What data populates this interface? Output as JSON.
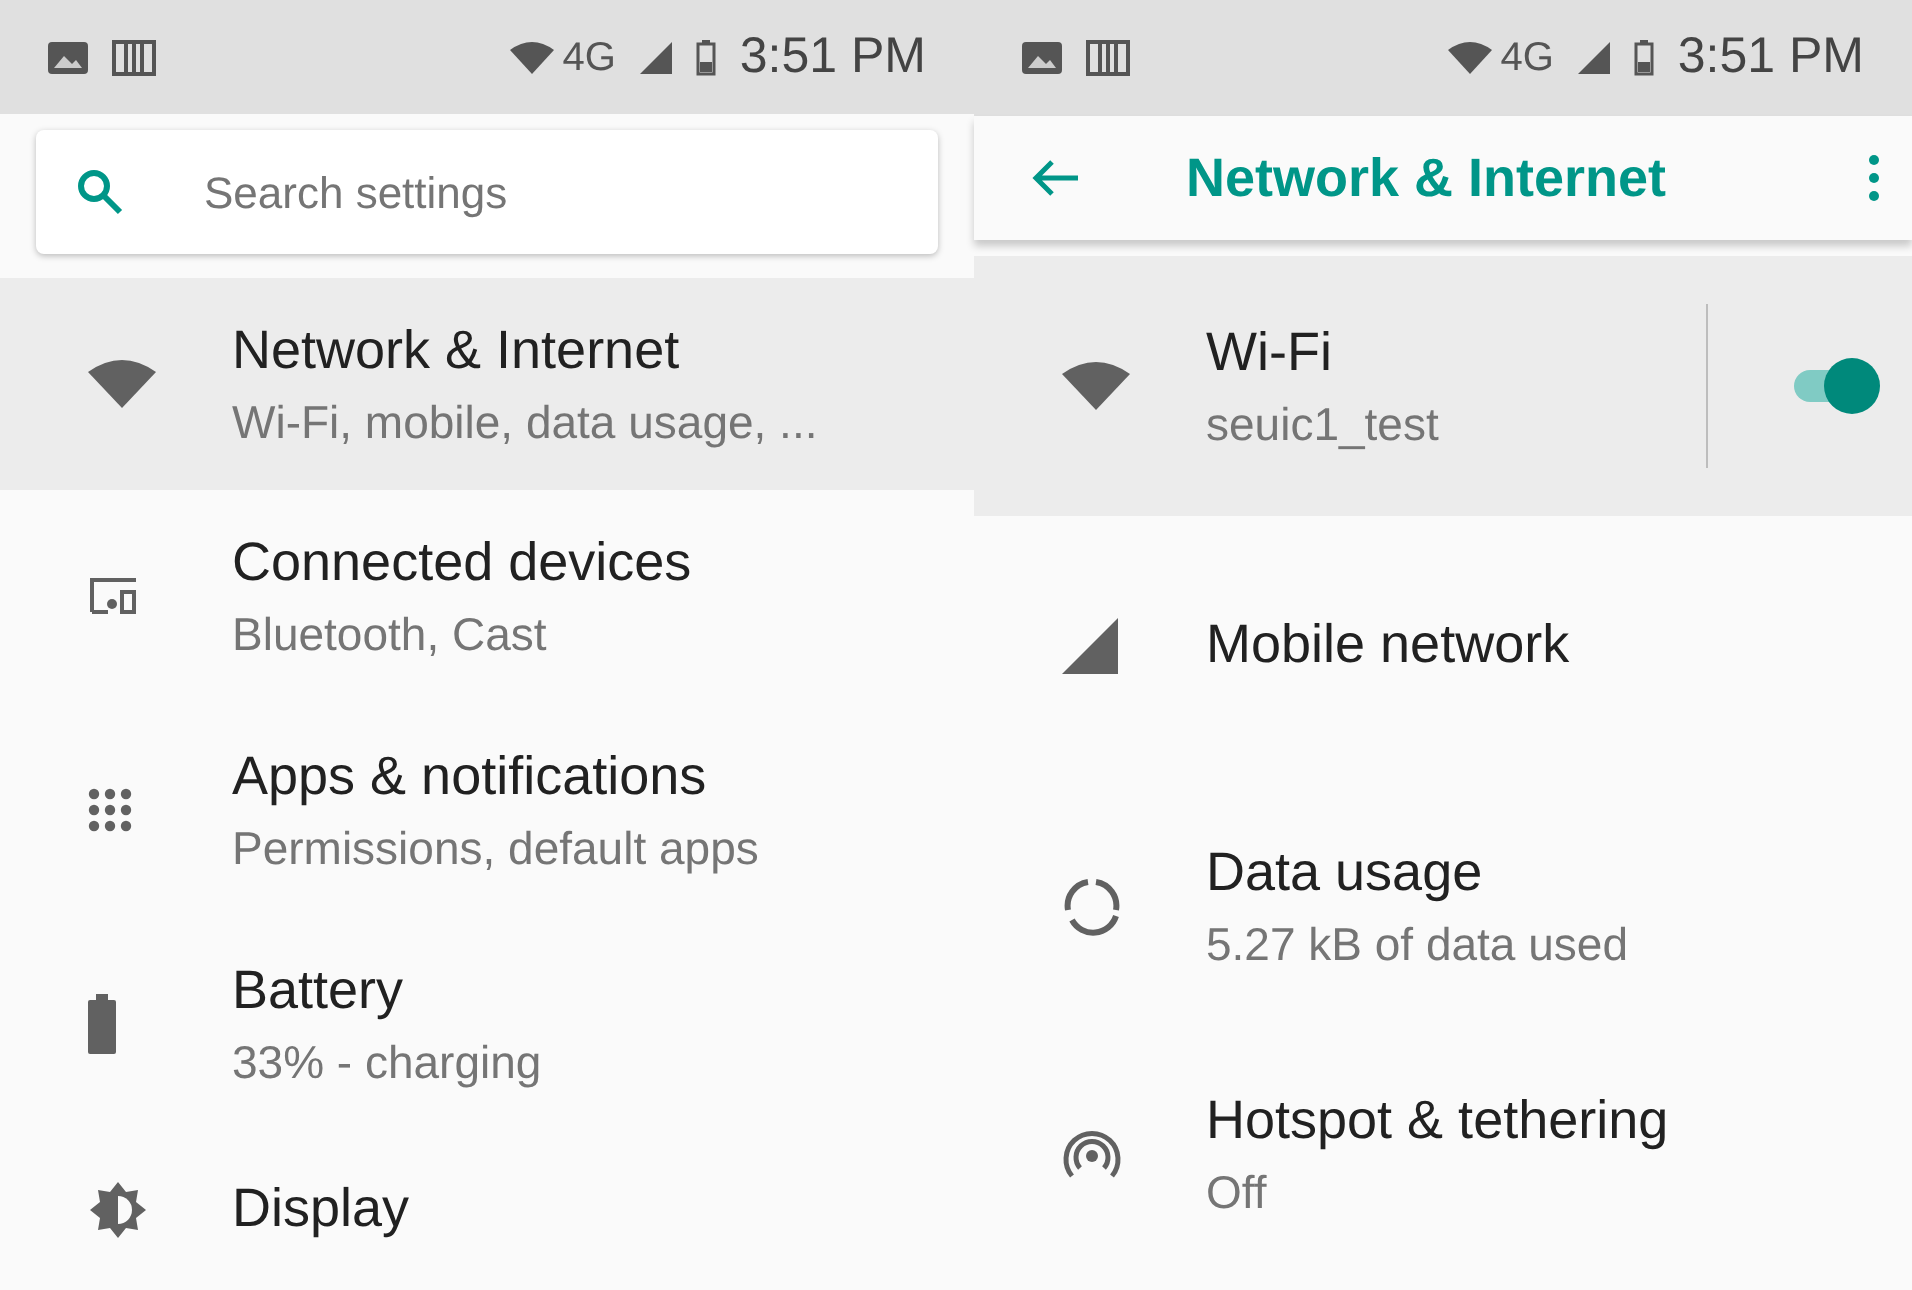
{
  "left_screen": {
    "status_bar": {
      "time": "3:51 PM",
      "network": "4G"
    },
    "search": {
      "placeholder": "Search settings"
    },
    "items": [
      {
        "title": "Network & Internet",
        "subtitle": "Wi-Fi, mobile, data usage, ...",
        "kind": "wifi",
        "selected": true
      },
      {
        "title": "Connected devices",
        "subtitle": "Bluetooth, Cast",
        "kind": "devices",
        "selected": false
      },
      {
        "title": "Apps & notifications",
        "subtitle": "Permissions, default apps",
        "kind": "apps",
        "selected": false
      },
      {
        "title": "Battery",
        "subtitle": "33% - charging",
        "kind": "battery",
        "selected": false
      },
      {
        "title": "Display",
        "kind": "display",
        "selected": false
      }
    ]
  },
  "right_screen": {
    "status_bar": {
      "time": "3:51 PM",
      "network": "4G"
    },
    "toolbar": {
      "title": "Network & Internet"
    },
    "items": [
      {
        "title": "Wi-Fi",
        "subtitle": "seuic1_test",
        "kind": "wifi",
        "selected": true,
        "toggle": {
          "on": true
        }
      },
      {
        "title": "Mobile network",
        "kind": "signal",
        "selected": false
      },
      {
        "title": "Data usage",
        "subtitle": "5.27 kB of data used",
        "kind": "data",
        "selected": false
      },
      {
        "title": "Hotspot & tethering",
        "subtitle": "Off",
        "kind": "hotspot",
        "selected": false
      }
    ]
  }
}
